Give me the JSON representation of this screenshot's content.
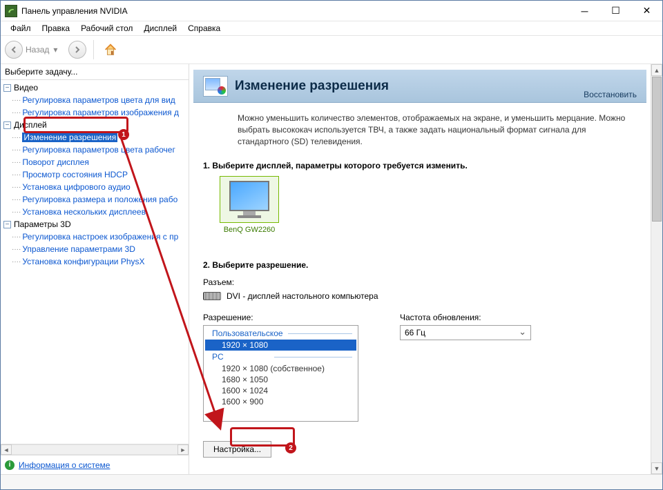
{
  "window": {
    "title": "Панель управления NVIDIA"
  },
  "menu": {
    "file": "Файл",
    "edit": "Правка",
    "desktop": "Рабочий стол",
    "display": "Дисплей",
    "help": "Справка"
  },
  "toolbar": {
    "back": "Назад",
    "home": "home"
  },
  "sidebar": {
    "task_label": "Выберите задачу...",
    "video_cat": "Видео",
    "video_items": [
      "Регулировка параметров цвета для вид",
      "Регулировка параметров изображения д"
    ],
    "display_cat": "Дисплей",
    "display_items": [
      "Изменение разрешения",
      "Регулировка параметров цвета рабочег",
      "Поворот дисплея",
      "Просмотр состояния HDCP",
      "Установка цифрового аудио",
      "Регулировка размера и положения рабо",
      "Установка нескольких дисплеев"
    ],
    "params3d_cat": "Параметры 3D",
    "params3d_items": [
      "Регулировка настроек изображения с пр",
      "Управление параметрами 3D",
      "Установка конфигурации PhysX"
    ],
    "sysinfo": "Информация о системе"
  },
  "page": {
    "title": "Изменение разрешения",
    "restore": "Восстановить",
    "description": "Можно уменьшить количество элементов, отображаемых на экране, и уменьшить мерцание. Можно выбрать высококач используется ТВЧ, а также задать национальный формат сигнала для стандартного (SD) телевидения.",
    "step1": "1. Выберите дисплей, параметры которого требуется изменить.",
    "monitor_name": "BenQ GW2260",
    "step2": "2. Выберите разрешение.",
    "port_label": "Разъем:",
    "port_value": "DVI - дисплей настольного компьютера",
    "res_label": "Разрешение:",
    "refresh_label": "Частота обновления:",
    "refresh_value": "66 Гц",
    "res_group_custom": "Пользовательское",
    "res_group_pc": "PC",
    "res_custom": [
      "1920 × 1080"
    ],
    "res_pc": [
      "1920 × 1080 (собственное)",
      "1680 × 1050",
      "1600 × 1024",
      "1600 × 900"
    ],
    "config_btn": "Настройка..."
  },
  "annot": {
    "n1": "1",
    "n2": "2"
  }
}
